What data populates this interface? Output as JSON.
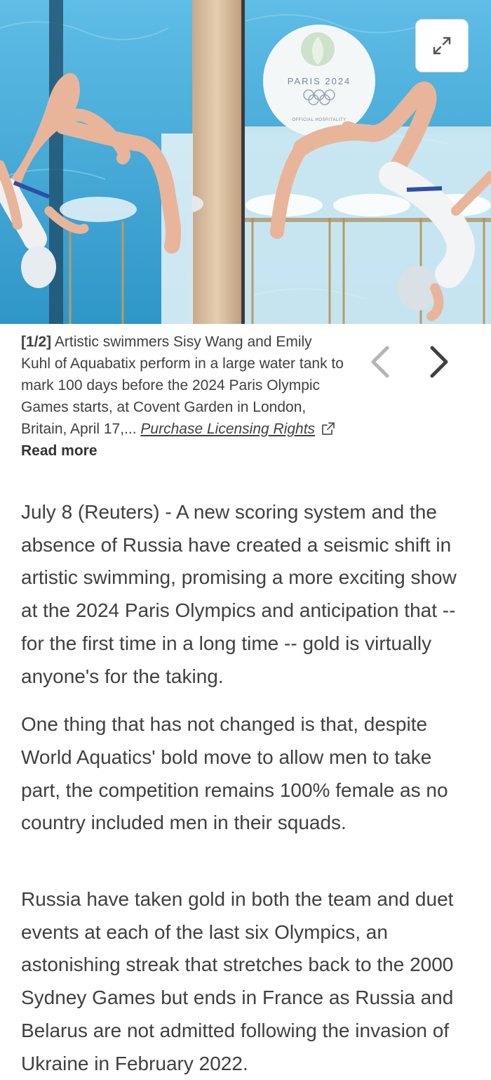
{
  "photo": {
    "logo_text": "PARIS 2024",
    "logo_subtext": "OFFICIAL HOSPITALITY",
    "colors": {
      "water": "#3aa6d6",
      "water_light": "#6cc3ea",
      "skin": "#e8b59a"
    },
    "expand_icon": "expand-arrows-icon"
  },
  "caption": {
    "counter": "[1/2]",
    "text": " Artistic swimmers Sisy Wang and Emily Kuhl of Aquabatix perform in a large water tank to mark 100 days before the 2024 Paris Olympic Games starts, at Covent Garden in London, Britain, April 17,... ",
    "license_link": "Purchase Licensing Rights",
    "read_more": "Read more",
    "prev_icon": "chevron-left-icon",
    "next_icon": "chevron-right-icon"
  },
  "article": {
    "paragraphs": [
      "July 8 (Reuters) - A new scoring system and the absence of Russia have created a seismic shift in artistic swimming, promising a more exciting show at the 2024 Paris Olympics and anticipation that -- for the first time in a long time -- gold is virtually anyone's for the taking.",
      "One thing that has not changed is that, despite World Aquatics' bold move to allow men to take part, the competition remains 100% female as no country included men in their squads.",
      "Russia have taken gold in both the team and duet events at each of the last six Olympics, an astonishing streak that stretches back to the 2000 Sydney Games but ends in France as Russia and Belarus are not admitted following the invasion of Ukraine in February 2022."
    ]
  }
}
